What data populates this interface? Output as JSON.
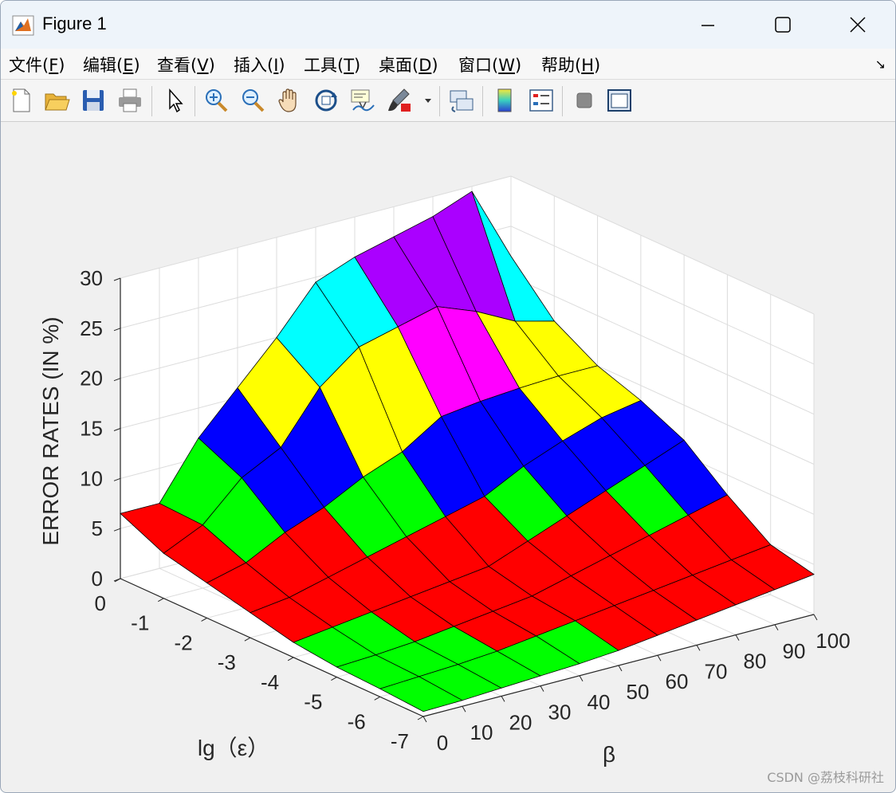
{
  "window": {
    "title": "Figure 1"
  },
  "menubar": {
    "items": [
      {
        "label": "文件(",
        "mnemonic": "F",
        "tail": ")"
      },
      {
        "label": "编辑(",
        "mnemonic": "E",
        "tail": ")"
      },
      {
        "label": "查看(",
        "mnemonic": "V",
        "tail": ")"
      },
      {
        "label": "插入(",
        "mnemonic": "I",
        "tail": ")"
      },
      {
        "label": "工具(",
        "mnemonic": "T",
        "tail": ")"
      },
      {
        "label": "桌面(",
        "mnemonic": "D",
        "tail": ")"
      },
      {
        "label": "窗口(",
        "mnemonic": "W",
        "tail": ")"
      },
      {
        "label": "帮助(",
        "mnemonic": "H",
        "tail": ")"
      }
    ]
  },
  "toolbar": {
    "icons": [
      "new-figure-icon",
      "open-file-icon",
      "save-icon",
      "print-icon",
      "pointer-icon",
      "zoom-in-icon",
      "zoom-out-icon",
      "pan-hand-icon",
      "rotate-3d-icon",
      "data-cursor-icon",
      "brush-icon",
      "brush-dropdown-icon",
      "link-plot-icon",
      "colorbar-icon",
      "legend-icon",
      "hide-plot-tools-icon",
      "show-plot-tools-icon"
    ]
  },
  "chart_data": {
    "type": "surface",
    "xlabel": "lg（ε）",
    "ylabel": "β",
    "zlabel": "ERROR RATES (IN %)",
    "xlim": [
      -7,
      0
    ],
    "ylim": [
      0,
      100
    ],
    "zlim": [
      0,
      30
    ],
    "x": [
      0,
      -1,
      -2,
      -3,
      -4,
      -5,
      -6,
      -7
    ],
    "y": [
      0,
      10,
      20,
      30,
      40,
      50,
      60,
      70,
      80,
      90,
      100
    ],
    "xticks": [
      "0",
      "-1",
      "-2",
      "-3",
      "-4",
      "-5",
      "-6",
      "-7"
    ],
    "yticks": [
      "0",
      "10",
      "20",
      "30",
      "40",
      "50",
      "60",
      "70",
      "80",
      "90",
      "100"
    ],
    "zticks": [
      "0",
      "5",
      "10",
      "15",
      "20",
      "25",
      "30"
    ],
    "grid": true,
    "z": [
      [
        6.5,
        6.5,
        12,
        16,
        20,
        24.5,
        26,
        27,
        28,
        29.5,
        22
      ],
      [
        4.5,
        6.3,
        10,
        12,
        17,
        20,
        21,
        22,
        20.5,
        18.5,
        17.5
      ],
      [
        3.5,
        4.5,
        6.5,
        8,
        10,
        11.5,
        14,
        14.5,
        14.8,
        15,
        15
      ],
      [
        2.5,
        3,
        4,
        5,
        6,
        7,
        8,
        10,
        11.5,
        12.8,
        13.5
      ],
      [
        1.5,
        2,
        2.5,
        3,
        3.5,
        4,
        5.5,
        7,
        8.5,
        10,
        11.5
      ],
      [
        1,
        1.2,
        1.5,
        2,
        2.5,
        3,
        4,
        5,
        6,
        7,
        8
      ],
      [
        0.8,
        1,
        1.2,
        1.5,
        2,
        2.5,
        3,
        3.5,
        4,
        4.5,
        5
      ],
      [
        0.5,
        0.6,
        0.8,
        1,
        1.2,
        1.5,
        2,
        2.5,
        3,
        3.5,
        4
      ]
    ],
    "color_bands": [
      {
        "max": 1.8,
        "color": "#00ff00"
      },
      {
        "max": 6.8,
        "color": "#ff0000"
      },
      {
        "max": 9.0,
        "color": "#00ff00"
      },
      {
        "max": 13.0,
        "color": "#0000ff"
      },
      {
        "max": 17.8,
        "color": "#ffff00"
      },
      {
        "max": 20.3,
        "color": "#ff00ff"
      },
      {
        "max": 23.0,
        "color": "#00ffff"
      },
      {
        "max": 99,
        "color": "#aa00ff"
      }
    ]
  },
  "watermark": {
    "text": "CSDN @荔枝科研社"
  }
}
